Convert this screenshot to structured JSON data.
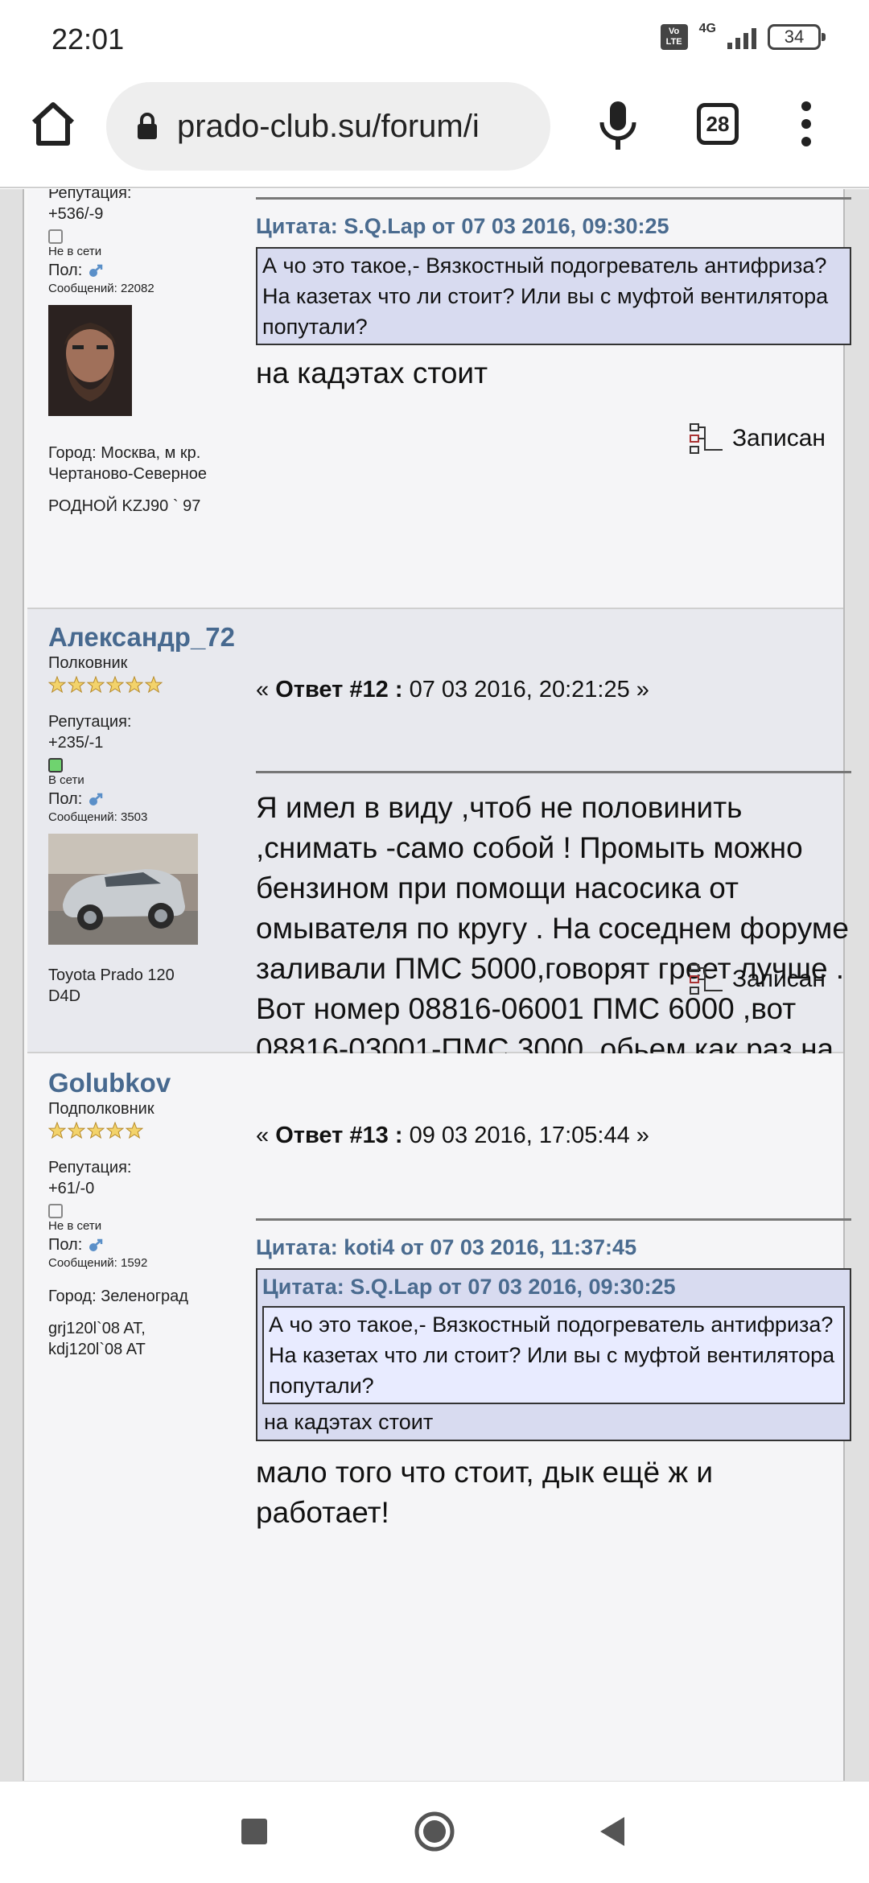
{
  "status_bar": {
    "time": "22:01",
    "volte": "Vo LTE",
    "network": "4G",
    "battery": "34"
  },
  "browser": {
    "url": "prado-club.su/forum/i",
    "tab_count": "28"
  },
  "posts": [
    {
      "poster": {
        "reputation_label": "Репутация:",
        "reputation": "+536/-9",
        "status": "Не в сети",
        "gender_label": "Пол:",
        "messages": "Сообщений: 22082",
        "city": "Город: Москва, м кр. Чертаново-Северное",
        "signature": "РОДНОЙ KZJ90 ` 97"
      },
      "quote_head": "Цитата: S.Q.Lap от 07 03 2016, 09:30:25",
      "quote_text": "А чо это такое,- Вязкостный подогреватель антифриза? На казетах что ли стоит? Или вы с муфтой вентилятора попутали?",
      "body": "на кадэтах стоит",
      "recorded": "Записан"
    },
    {
      "poster": {
        "name": "Александр_72",
        "rank": "Полковник",
        "reputation_label": "Репутация:",
        "reputation": "+235/-1",
        "status": "В сети",
        "gender_label": "Пол:",
        "messages": "Сообщений: 3503",
        "signature": "Toyota Prado 120 D4D"
      },
      "header_prefix": "«",
      "header_label": "Ответ #12 :",
      "header_date": "07 03 2016, 20:21:25 »",
      "body": "Я имел в виду ,чтоб не половинить ,снимать -само собой ! Промыть можно бензином при помощи насосика от омывателя по кругу . На соседнем форуме заливали ПМС 5000,говорят греет лучше . Вот номер   08816-06001 ПМС 6000 ,вот 08816-03001-ПМС 3000, обьем как раз на одну заправку",
      "recorded": "Записан"
    },
    {
      "poster": {
        "name": "Golubkov",
        "rank": "Подполковник",
        "reputation_label": "Репутация:",
        "reputation": "+61/-0",
        "status": "Не в сети",
        "gender_label": "Пол:",
        "messages": "Сообщений: 1592",
        "city": "Город: Зеленоград",
        "signature": "grj120l`08 AT, kdj120l`08 AT"
      },
      "header_prefix": "«",
      "header_label": "Ответ #13 :",
      "header_date": "09 03 2016, 17:05:44 »",
      "quote_head": "Цитата: koti4 от 07 03 2016, 11:37:45",
      "inner_quote_head": "Цитата: S.Q.Lap от 07 03 2016, 09:30:25",
      "inner_quote_text": "А чо это такое,- Вязкостный подогреватель антифриза? На казетах что ли стоит? Или вы с муфтой вентилятора попутали?",
      "quote_tail": "на кадэтах стоит",
      "body": "мало того что стоит, дык ещё ж и работает!"
    }
  ],
  "colors": {
    "link_blue": "#47698f",
    "quote_bg": "#d8dbf0",
    "online_green": "#6fd36f"
  },
  "icons": [
    "home-icon",
    "lock-icon",
    "mic-icon",
    "more-vert-icon",
    "gender-male-icon",
    "star-icon",
    "recorded-icon",
    "smiley-icon",
    "nav-recents-icon",
    "nav-home-icon",
    "nav-back-icon"
  ]
}
